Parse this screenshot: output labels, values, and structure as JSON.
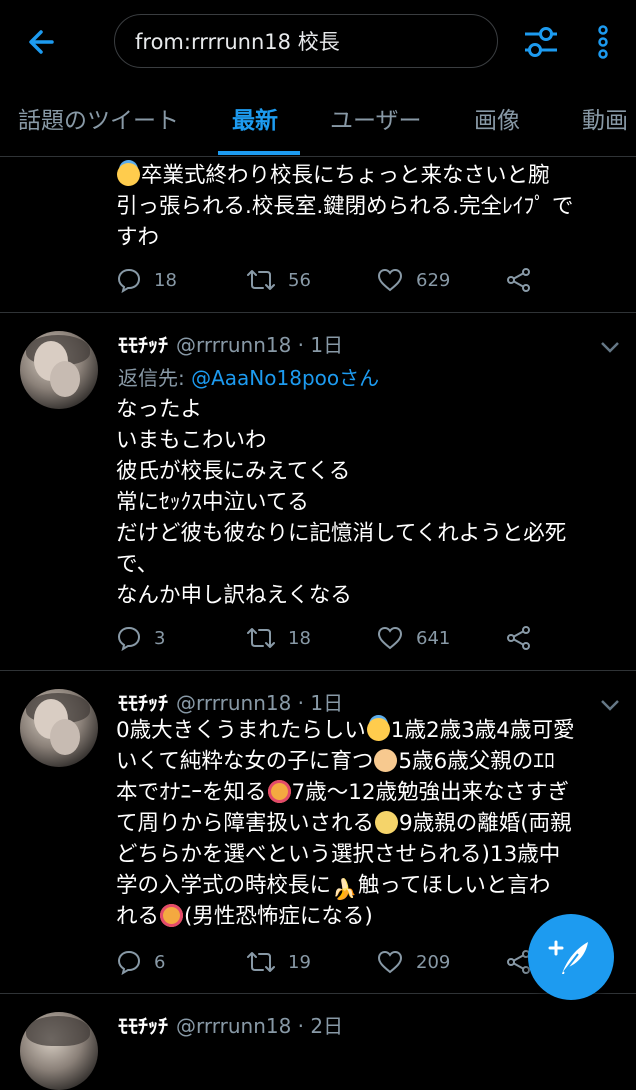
{
  "search": {
    "query": "from:rrrrunn18 校長"
  },
  "tabs": [
    "話題のツイート",
    "最新",
    "ユーザー",
    "画像",
    "動画"
  ],
  "tweets": [
    {
      "lines": [
        "卒業式終わり校長にちょっと来なさいと腕",
        "引っ張られる.校長室.鍵閉められる.完全ﾚｲﾌﾟ で",
        "すわ"
      ],
      "replies": "18",
      "retweets": "56",
      "likes": "629"
    },
    {
      "name": "ﾓﾓﾁｯﾁ",
      "handle": "@rrrrunn18",
      "time": "· 1日",
      "reply_label": "返信先:",
      "reply_to": "@AaaNo18pooさん",
      "lines": [
        "なったよ",
        "いまもこわいわ",
        "彼氏が校長にみえてくる",
        "常にｾｯｸｽ中泣いてる",
        "だけど彼も彼なりに記憶消してくれようと必死",
        "で、",
        "なんか申し訳ねえくなる"
      ],
      "replies": "3",
      "retweets": "18",
      "likes": "641"
    },
    {
      "name": "ﾓﾓﾁｯﾁ",
      "handle": "@rrrrunn18",
      "time": "· 1日",
      "segments": [
        "0歳大きくうまれたらしい",
        "1歳2歳3歳4歳可愛",
        "いくて純粋な女の子に育つ",
        "5歳6歳父親のｴﾛ",
        "本でｵﾅﾆｰを知る",
        "7歳〜12歳勉強出来なさすぎ",
        "て周りから障害扱いされる",
        "9歳親の離婚(両親",
        "どちらかを選べという選択させられる)13歳中",
        "学の入学式の時校長に",
        "触ってほしいと言わ",
        "れる",
        "(男性恐怖症になる)"
      ],
      "replies": "6",
      "retweets": "19",
      "likes": "209"
    },
    {
      "name": "ﾓﾓﾁｯﾁ",
      "handle": "@rrrrunn18",
      "time": "· 2日"
    }
  ]
}
